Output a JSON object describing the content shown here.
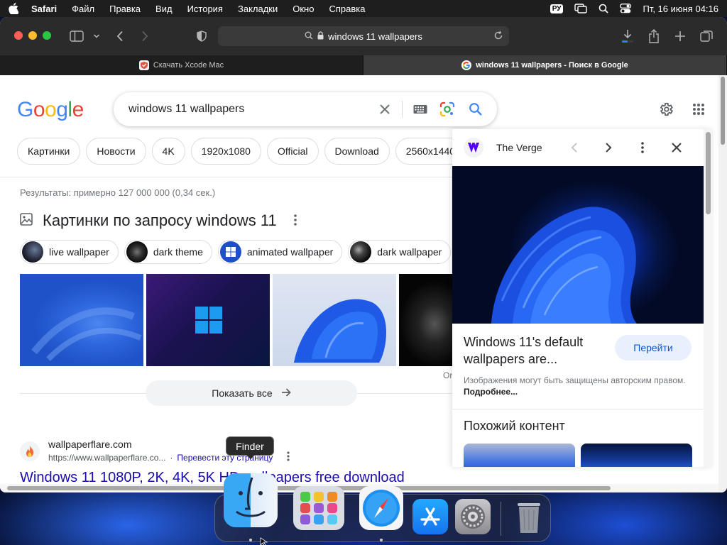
{
  "menubar": {
    "app": "Safari",
    "items": [
      "Файл",
      "Правка",
      "Вид",
      "История",
      "Закладки",
      "Окно",
      "Справка"
    ],
    "input_source": "РУ",
    "datetime": "Пт, 16 июня  04:16"
  },
  "browser": {
    "address": "windows 11 wallpapers",
    "tabs": [
      {
        "label": "Скачать Xcode Mac",
        "active": false
      },
      {
        "label": "windows 11 wallpapers - Поиск в Google",
        "active": true
      }
    ]
  },
  "google": {
    "logo": [
      "G",
      "o",
      "o",
      "g",
      "l",
      "e"
    ],
    "logo_colors": [
      "#4285F4",
      "#EA4335",
      "#FBBC05",
      "#4285F4",
      "#34A853",
      "#EA4335"
    ],
    "query": "windows 11 wallpapers",
    "filters": [
      "Картинки",
      "Новости",
      "4K",
      "1920x1080",
      "Official",
      "Download",
      "2560x1440"
    ],
    "stats": "Результаты: примерно 127 000 000 (0,34 сек.)",
    "images_heading": "Картинки по запросу windows 11",
    "refine_pills": [
      "live wallpaper",
      "dark theme",
      "animated wallpaper",
      "dark wallpaper"
    ],
    "show_all": "Показать все",
    "fragment": "Or",
    "result": {
      "site": "wallpaperflare.com",
      "url": "https://www.wallpaperflare.co...",
      "translate": "Перевести эту страницу",
      "title": "Windows 11 1080P, 2K, 4K, 5K HD wallpapers free download"
    }
  },
  "panel": {
    "source": "The Verge",
    "title": "Windows 11's default wallpapers are...",
    "go_button": "Перейти",
    "copyright_text": "Изображения могут быть защищены авторским правом.",
    "copyright_link": "Подробнее...",
    "similar_heading": "Похожий контент"
  },
  "dock": {
    "tooltip": "Finder",
    "apps": [
      "finder-icon",
      "launchpad-icon",
      "safari-icon",
      "app-store-icon",
      "system-settings-icon",
      "trash-icon"
    ]
  },
  "colors": {
    "link": "#1a0dab",
    "accent_button_bg": "#e8f0fe",
    "accent_button_fg": "#0b57d0",
    "menubar_bg": "#1e1e1e",
    "toolbar_bg": "#2b2b2b"
  }
}
